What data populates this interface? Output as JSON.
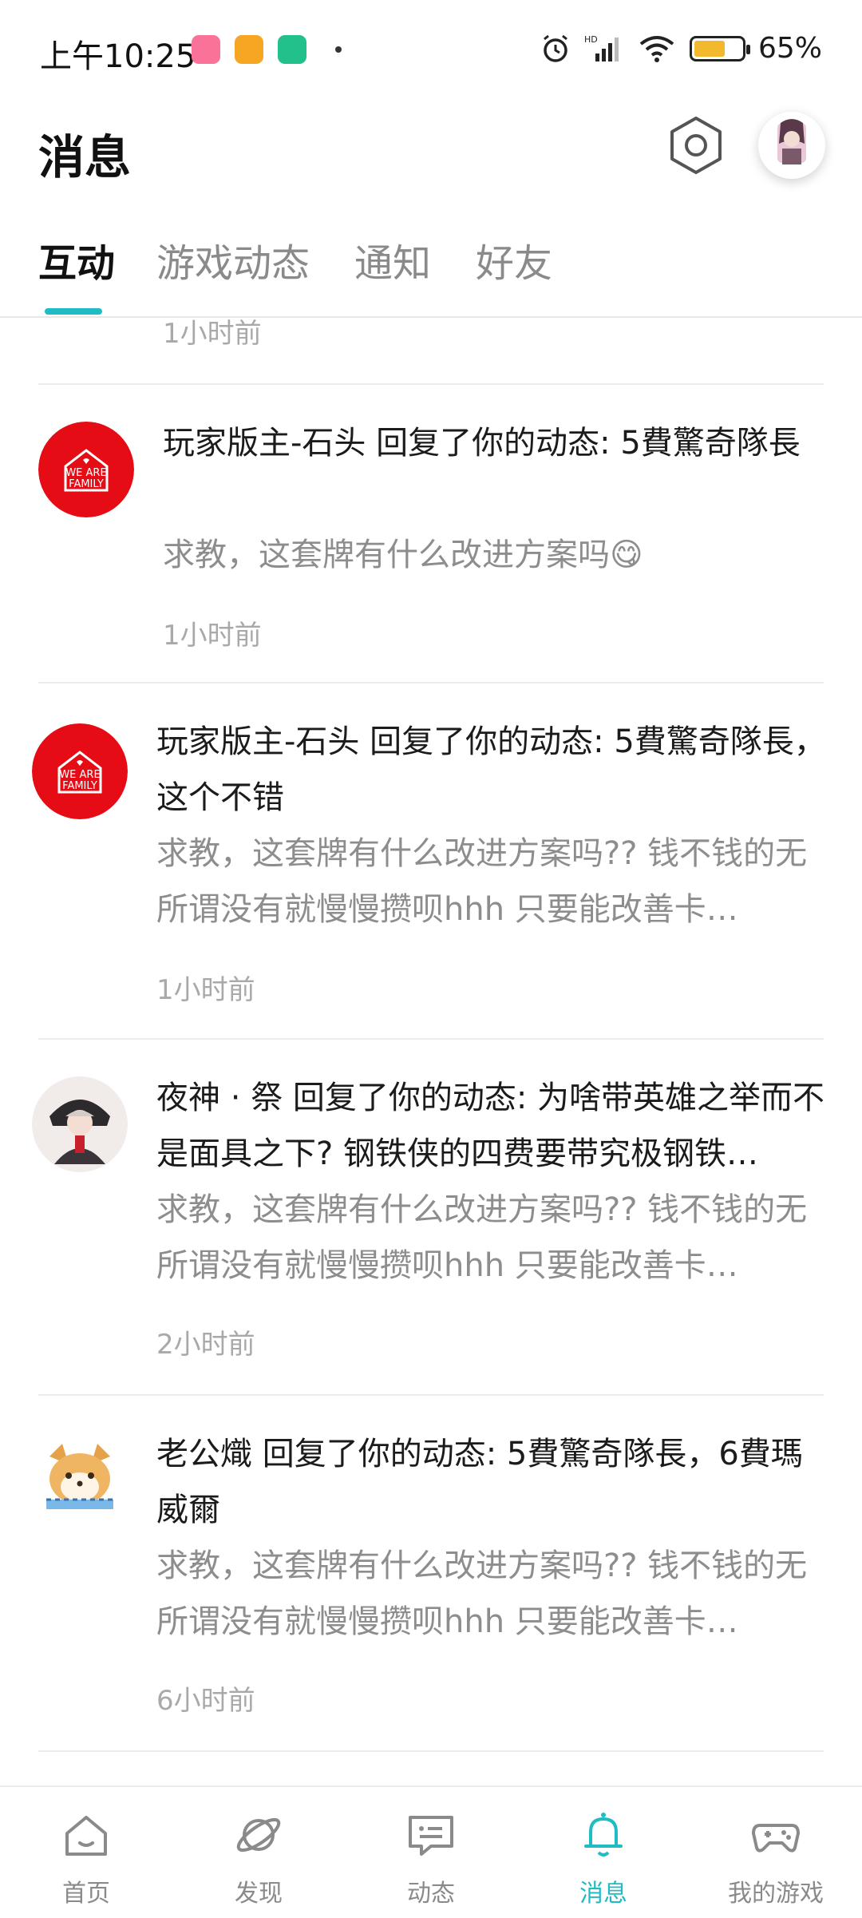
{
  "status_bar": {
    "time": "上午10:25",
    "battery_percent": "65%",
    "battery_level": 0.65,
    "app_icons": [
      "bilibili-icon",
      "reader-icon",
      "shield-icon"
    ],
    "colors": {
      "bilibili": "#fb7299",
      "reader": "#f6a623",
      "shield": "#22c08a"
    }
  },
  "header": {
    "title": "消息"
  },
  "tabs": [
    {
      "label": "互动",
      "active": true
    },
    {
      "label": "游戏动态",
      "active": false
    },
    {
      "label": "通知",
      "active": false
    },
    {
      "label": "好友",
      "active": false
    }
  ],
  "feed": {
    "partial_time": "1小时前",
    "messages": [
      {
        "avatar": "we-are-family-logo",
        "title": "玩家版主-石头 回复了你的动态: 5費驚奇隊長",
        "body": "求教，这套牌有什么改进方案吗😋",
        "time": "1小时前"
      },
      {
        "avatar": "we-are-family-logo",
        "title": "玩家版主-石头 回复了你的动态: 5費驚奇隊長，这个不错",
        "body": "求教，这套牌有什么改进方案吗?? 钱不钱的无所谓没有就慢慢攒呗hhh 只要能改善卡…",
        "time": "1小时前"
      },
      {
        "avatar": "anime-girl-avatar",
        "title": "夜神 · 祭 回复了你的动态: 为啥带英雄之举而不是面具之下? 钢铁侠的四费要带究极钢铁…",
        "body": "求教，这套牌有什么改进方案吗?? 钱不钱的无所谓没有就慢慢攒呗hhh 只要能改善卡…",
        "time": "2小时前"
      },
      {
        "avatar": "shiba-dog-avatar",
        "title": "老公熾 回复了你的动态: 5費驚奇隊長，6費瑪威爾",
        "body": "求教，这套牌有什么改进方案吗?? 钱不钱的无所谓没有就慢慢攒呗hhh 只要能改善卡…",
        "time": "6小时前"
      }
    ]
  },
  "bottom_nav": [
    {
      "label": "首页",
      "icon": "home-icon",
      "active": false
    },
    {
      "label": "发现",
      "icon": "planet-icon",
      "active": false
    },
    {
      "label": "动态",
      "icon": "chat-icon",
      "active": false
    },
    {
      "label": "消息",
      "icon": "bell-icon",
      "active": true
    },
    {
      "label": "我的游戏",
      "icon": "gamepad-icon",
      "active": false
    }
  ],
  "accent_color": "#1fbcc4",
  "logo_text": [
    "WE ARE",
    "FAMILY"
  ]
}
